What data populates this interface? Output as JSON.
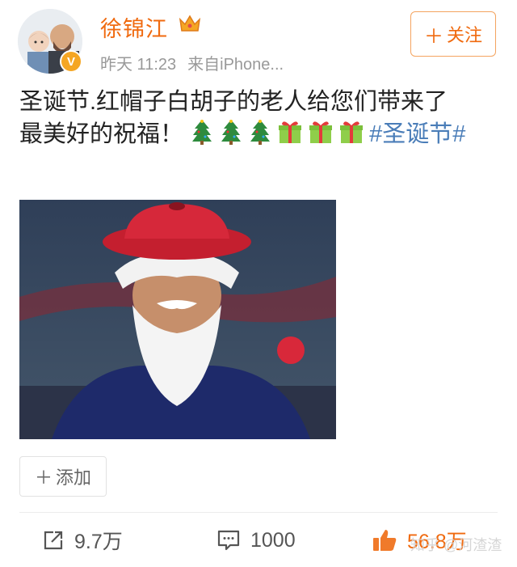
{
  "author": {
    "name": "徐锦江",
    "verified_badge": "V",
    "time": "昨天 11:23",
    "source": "来自iPhone..."
  },
  "follow_button": {
    "label": "关注"
  },
  "post": {
    "text_line1": "圣诞节.红帽子白胡子的老人给您们带来了",
    "text_line2": "最美好的祝福！",
    "hashtag": "#圣诞节#",
    "emojis": [
      "christmas-tree",
      "christmas-tree",
      "christmas-tree",
      "gift",
      "gift",
      "gift"
    ]
  },
  "add_button": {
    "label": "添加"
  },
  "actions": {
    "repost_count": "9.7万",
    "comment_count": "1000",
    "like_count": "56.8万"
  },
  "watermark": "知乎 @河渣渣",
  "colors": {
    "accent": "#f06a0f",
    "link": "#4a7db8",
    "muted": "#999999"
  }
}
